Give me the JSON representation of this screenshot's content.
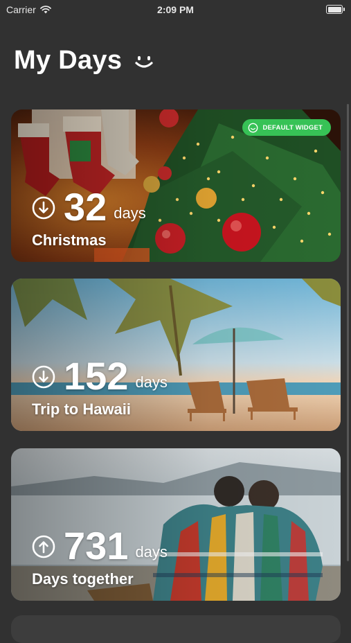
{
  "status": {
    "carrier": "Carrier",
    "time": "2:09 PM"
  },
  "header": {
    "title": "My Days",
    "icon": "smile-icon"
  },
  "cards": [
    {
      "count": "32",
      "unit": "days",
      "name": "Christmas",
      "direction": "down",
      "badge": "DEFAULT WIDGET",
      "theme": "christmas"
    },
    {
      "count": "152",
      "unit": "days",
      "name": "Trip to Hawaii",
      "direction": "down",
      "theme": "beach"
    },
    {
      "count": "731",
      "unit": "days",
      "name": "Days together",
      "direction": "up",
      "theme": "lake"
    }
  ],
  "colors": {
    "background": "#313131",
    "badge": "#37c256"
  }
}
